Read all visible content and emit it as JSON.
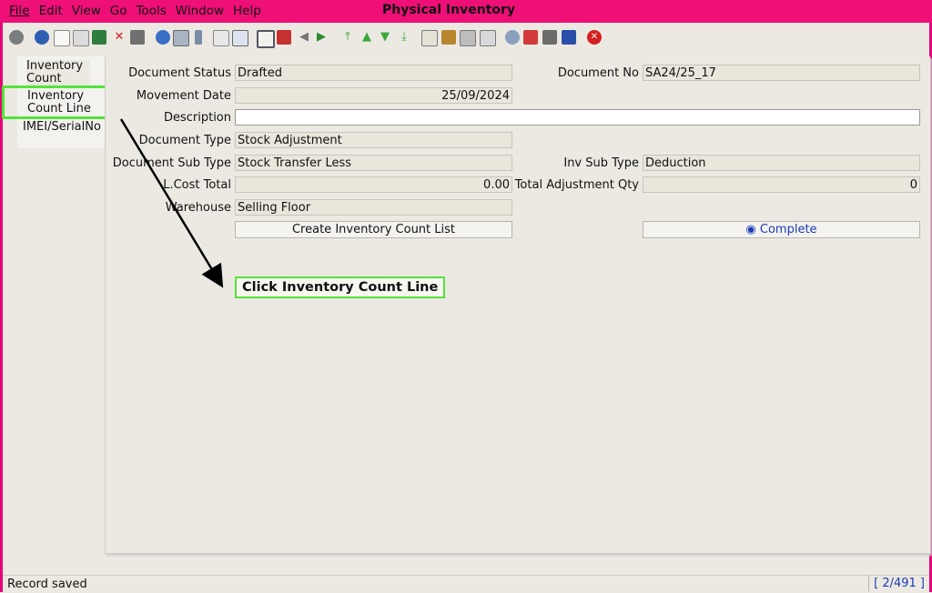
{
  "window": {
    "title": "Physical Inventory"
  },
  "menu": [
    {
      "label": "File"
    },
    {
      "label": "Edit"
    },
    {
      "label": "View"
    },
    {
      "label": "Go"
    },
    {
      "label": "Tools"
    },
    {
      "label": "Window"
    },
    {
      "label": "Help"
    }
  ],
  "toolbar_icons": [
    "undo-icon",
    "help-icon",
    "new-record-icon",
    "copy-record-icon",
    "save-icon",
    "delete-icon",
    "delete-selection-icon",
    "refresh-icon",
    "find-icon",
    "attachment-icon",
    "chat-icon",
    "history-icon",
    "report-icon",
    "home-icon",
    "back-icon",
    "forward-icon",
    "first-record-icon",
    "previous-record-icon",
    "next-record-icon",
    "last-record-icon",
    "workflow-icon",
    "product-info-icon",
    "print-icon",
    "print-preview-icon",
    "zoom-across-icon",
    "request-icon",
    "archive-icon",
    "end-icon",
    "close-icon"
  ],
  "tabs": [
    {
      "label": "Inventory Count"
    },
    {
      "label": "Inventory Count Line"
    },
    {
      "label": "IMEI/SerialNo"
    }
  ],
  "form": {
    "document_status_label": "Document Status",
    "document_status_value": "Drafted",
    "document_no_label": "Document No",
    "document_no_value": "SA24/25_17",
    "movement_date_label": "Movement Date",
    "movement_date_value": "25/09/2024",
    "description_label": "Description",
    "description_value": "",
    "document_type_label": "Document Type",
    "document_type_value": "Stock Adjustment",
    "document_sub_type_label": "Document Sub Type",
    "document_sub_type_value": "Stock Transfer Less",
    "inv_sub_type_label": "Inv Sub Type",
    "inv_sub_type_value": "Deduction",
    "lcost_total_label": "L.Cost Total",
    "lcost_total_value": "0.00",
    "total_adjustment_qty_label": "Total Adjustment Qty",
    "total_adjustment_qty_value": "0",
    "warehouse_label": "Warehouse",
    "warehouse_value": "Selling Floor",
    "create_list_button": "Create Inventory Count List",
    "complete_button": "Complete"
  },
  "annotation": {
    "callout": "Click Inventory Count Line"
  },
  "status": {
    "message": "Record saved",
    "record_count": "[ 2/491 ]"
  },
  "colors": {
    "title_bar": "#ee0f77",
    "highlight": "#55e33a",
    "link_blue": "#1b3bb6"
  }
}
